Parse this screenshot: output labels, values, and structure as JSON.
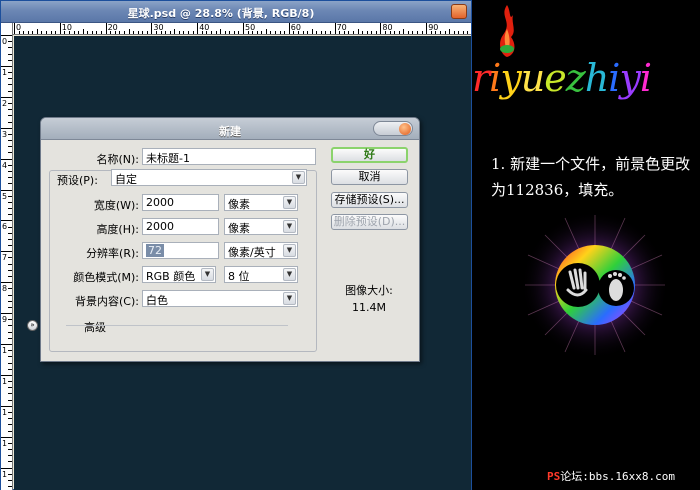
{
  "window": {
    "title": "星球.psd @ 28.8% (背景, RGB/8)"
  },
  "ruler": {
    "h_labels": [
      "0",
      "10",
      "20",
      "30",
      "40",
      "50",
      "60",
      "70",
      "80",
      "90"
    ],
    "v_labels": [
      "0",
      "1",
      "2",
      "3",
      "4",
      "5",
      "6",
      "7",
      "8",
      "9",
      "1",
      "1",
      "1",
      "1",
      "1"
    ]
  },
  "canvas": {
    "color": "#112836"
  },
  "dialog": {
    "title": "新建",
    "name_label": "名称(N):",
    "name_value": "未标题-1",
    "preset_label": "预设(P):",
    "preset_value": "自定",
    "width_label": "宽度(W):",
    "width_value": "2000",
    "width_unit": "像素",
    "height_label": "高度(H):",
    "height_value": "2000",
    "height_unit": "像素",
    "res_label": "分辨率(R):",
    "res_value": "72",
    "res_unit": "像素/英寸",
    "mode_label": "颜色模式(M):",
    "mode_value": "RGB 颜色",
    "depth_value": "8 位",
    "bg_label": "背景内容(C):",
    "bg_value": "白色",
    "advanced_label": "高级",
    "ok": "好",
    "cancel": "取消",
    "save_preset": "存储预设(S)...",
    "delete_preset": "删除预设(D)...",
    "image_size_label": "图像大小:",
    "image_size_value": "11.4M"
  },
  "panel": {
    "logo_letters": [
      "r",
      "i",
      "y",
      "u",
      "e",
      "z",
      "h",
      "i",
      "y",
      "i"
    ],
    "logo_colors": [
      "#ff2a2a",
      "#ff7a1a",
      "#ffd21a",
      "#ffe24a",
      "#c8e82a",
      "#39c23f",
      "#29b8d6",
      "#2a6cff",
      "#9a3cff",
      "#ff2ad0"
    ],
    "instruction": "1. 新建一个文件，前景色更改为112836，填充。",
    "footer_ps": "PS",
    "footer_text": "论坛:bbs.16xx8.com"
  }
}
